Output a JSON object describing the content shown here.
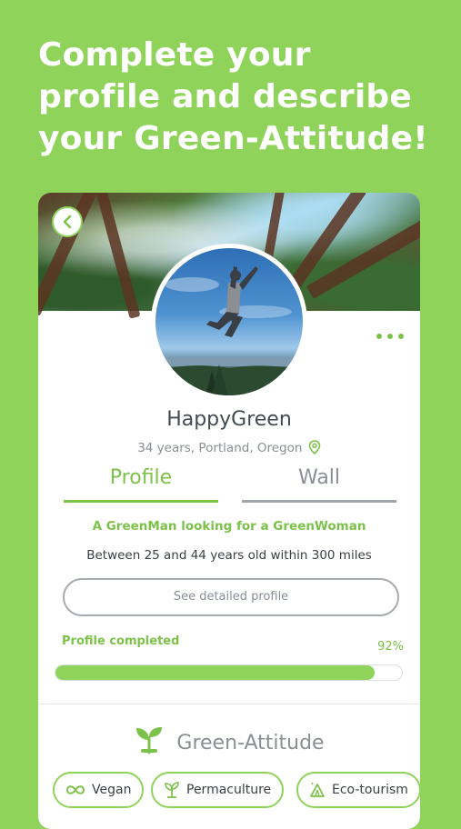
{
  "headline": {
    "line1": "Complete your",
    "line2": "profile and describe",
    "line3": "your Green-Attitude!"
  },
  "profile": {
    "username": "HappyGreen",
    "location": "34 years, Portland, Oregon"
  },
  "tabs": {
    "profile": "Profile",
    "wall": "Wall"
  },
  "tagline": "A GreenMan looking for a GreenWoman",
  "criteria": "Between 25 and 44 years old within 300 miles",
  "detail_button": "See detailed profile",
  "progress": {
    "label": "Profile completed",
    "value_text": "92%",
    "fraction": 0.92
  },
  "green_attitude": {
    "title": "Green-Attitude",
    "chips": [
      {
        "label": "Vegan",
        "icon": "infinity-icon"
      },
      {
        "label": "Permaculture",
        "icon": "plant-icon"
      },
      {
        "label": "Eco-tourism",
        "icon": "tent-icon"
      }
    ]
  },
  "colors": {
    "background": "#8fd35a",
    "accent": "#7cc24a",
    "muted": "#8a8f96"
  }
}
